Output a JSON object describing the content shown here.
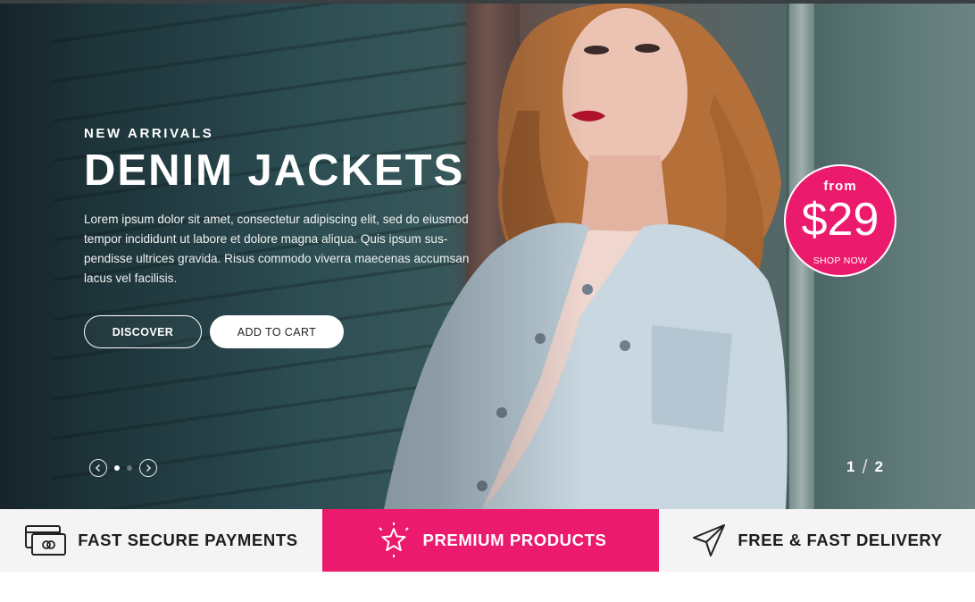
{
  "hero": {
    "eyebrow": "NEW ARRIVALS",
    "headline": "DENIM JACKETS",
    "description": "Lorem ipsum dolor sit amet, consectetur adipiscing elit, sed do eiusmod tempor incididunt ut labore et dolore magna aliqua. Quis ipsum sus-pendisse ultrices gravida. Risus commodo viverra maecenas accumsan lacus vel facilisis.",
    "discover_label": "DISCOVER",
    "add_to_cart_label": "ADD TO CART",
    "image_subject": "woman in light denim jacket leaning on wooden wall"
  },
  "price_badge": {
    "from": "from",
    "price": "$29",
    "cta": "SHOP NOW",
    "color": "#ec1a6d"
  },
  "slider": {
    "current": "1",
    "total": "2",
    "separator": "/",
    "dots": 2,
    "active_dot": 1
  },
  "features": [
    {
      "label": "FAST SECURE PAYMENTS",
      "icon": "credit-card-icon"
    },
    {
      "label": "PREMIUM PRODUCTS",
      "icon": "star-icon",
      "highlighted": true
    },
    {
      "label": "FREE & FAST DELIVERY",
      "icon": "paper-plane-icon"
    }
  ],
  "colors": {
    "accent": "#ec1a6d",
    "feature_bg": "#f4f4f4",
    "text_dark": "#1c1c1c"
  }
}
